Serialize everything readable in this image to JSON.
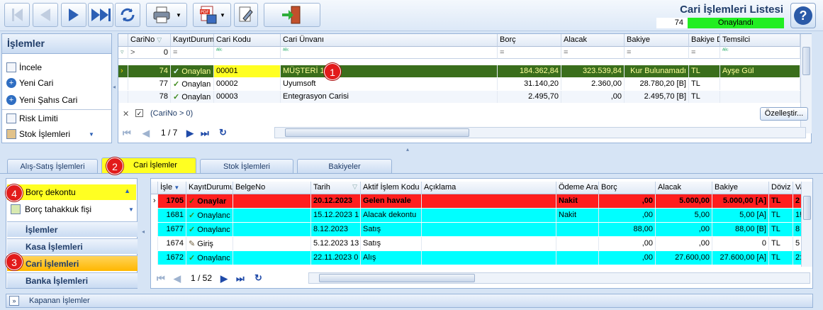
{
  "window": {
    "title": "Cari İşlemleri Listesi",
    "record_no": "74",
    "status": "Onaylandı"
  },
  "toolbar": {
    "icons": [
      "first-icon",
      "prev-icon",
      "next-icon",
      "last-icon",
      "refresh-icon",
      "print-icon",
      "pdf-save-icon",
      "edit-tool-icon",
      "exit-door-icon",
      "help-icon"
    ],
    "help_label": "?"
  },
  "ops": {
    "title": "İşlemler",
    "items": [
      "İncele",
      "Yeni Cari",
      "Yeni Şahıs Cari",
      "Risk Limiti",
      "Stok İşlemleri"
    ]
  },
  "grid1": {
    "columns": [
      "CariNo",
      "KayıtDurumu",
      "Cari Kodu",
      "Cari Ünvanı",
      "Borç",
      "Alacak",
      "Bakiye",
      "Bakiye D",
      "Temsilci"
    ],
    "filter_carino": "0",
    "filter_text": "(CariNo > 0)",
    "customize_label": "Özelleştir...",
    "rows": [
      {
        "carino": "74",
        "durum": "Onaylan",
        "kod": "00001",
        "unvan": "MÜŞTERİ 1",
        "borc": "184.362,84",
        "alacak": "323.539,84",
        "bakiye": "Kur Bulunamadı",
        "doviz": "TL",
        "temsilci": "Ayşe Gül"
      },
      {
        "carino": "77",
        "durum": "Onaylan",
        "kod": "00002",
        "unvan": "Uyumsoft",
        "borc": "31.140,20",
        "alacak": "2.360,00",
        "bakiye": "28.780,20 [B]",
        "doviz": "TL",
        "temsilci": ""
      },
      {
        "carino": "78",
        "durum": "Onaylan",
        "kod": "00003",
        "unvan": "Entegrasyon Carisi",
        "borc": "2.495,70",
        "alacak": ",00",
        "bakiye": "2.495,70 [B]",
        "doviz": "TL",
        "temsilci": ""
      }
    ],
    "pager": "1 / 7"
  },
  "tabs": [
    "Alış-Satış İşlemleri",
    "Cari İşlemler",
    "Stok İşlemleri",
    "Bakiyeler"
  ],
  "nav": {
    "items": [
      "Borç dekontu",
      "Borç tahakkuk fişi"
    ],
    "sections": [
      "İşlemler",
      "Kasa İşlemleri",
      "Cari İşlemleri",
      "Banka İşlemleri"
    ]
  },
  "grid2": {
    "columns": [
      "İşle",
      "KayıtDurumu",
      "BelgeNo",
      "Tarih",
      "Aktif İşlem Kodu",
      "Açıklama",
      "Ödeme Ara",
      "Borç",
      "Alacak",
      "Bakiye",
      "Döviz",
      "Va"
    ],
    "rows": [
      {
        "no": "1705",
        "durum": "Onaylar",
        "belge": "",
        "tarih": "20.12.2023",
        "kod": "Gelen havale",
        "aciklama": "",
        "odeme": "Nakit",
        "borc": ",00",
        "alacak": "5.000,00",
        "bakiye": "5.000,00 [A]",
        "doviz": "TL",
        "va": "2"
      },
      {
        "no": "1681",
        "durum": "Onaylanc",
        "belge": "",
        "tarih": "15.12.2023 1",
        "kod": "Alacak dekontu",
        "aciklama": "",
        "odeme": "Nakit",
        "borc": ",00",
        "alacak": "5,00",
        "bakiye": "5,00 [A]",
        "doviz": "TL",
        "va": "1!"
      },
      {
        "no": "1677",
        "durum": "Onaylanc",
        "belge": "",
        "tarih": "8.12.2023",
        "kod": "Satış",
        "aciklama": "",
        "odeme": "",
        "borc": "88,00",
        "alacak": ",00",
        "bakiye": "88,00 [B]",
        "doviz": "TL",
        "va": "8"
      },
      {
        "no": "1674",
        "durum": "Giriş",
        "belge": "",
        "tarih": "5.12.2023 13",
        "kod": "Satış",
        "aciklama": "",
        "odeme": "",
        "borc": ",00",
        "alacak": ",00",
        "bakiye": "0",
        "doviz": "TL",
        "va": "5"
      },
      {
        "no": "1672",
        "durum": "Onaylanc",
        "belge": "",
        "tarih": "22.11.2023 0",
        "kod": "Alış",
        "aciklama": "",
        "odeme": "",
        "borc": ",00",
        "alacak": "27.600,00",
        "bakiye": "27.600,00 [A]",
        "doviz": "TL",
        "va": "2:"
      }
    ],
    "pager": "1 / 52"
  },
  "closed_label": "Kapanan İşlemler",
  "badges": [
    "1",
    "2",
    "3",
    "4"
  ],
  "colors": {
    "selected_row": "#3a6e1c",
    "red_row": "#ff1e1e",
    "cyan_row": "#00ffff",
    "highlight": "#ffff22",
    "status_green": "#22ee22"
  }
}
